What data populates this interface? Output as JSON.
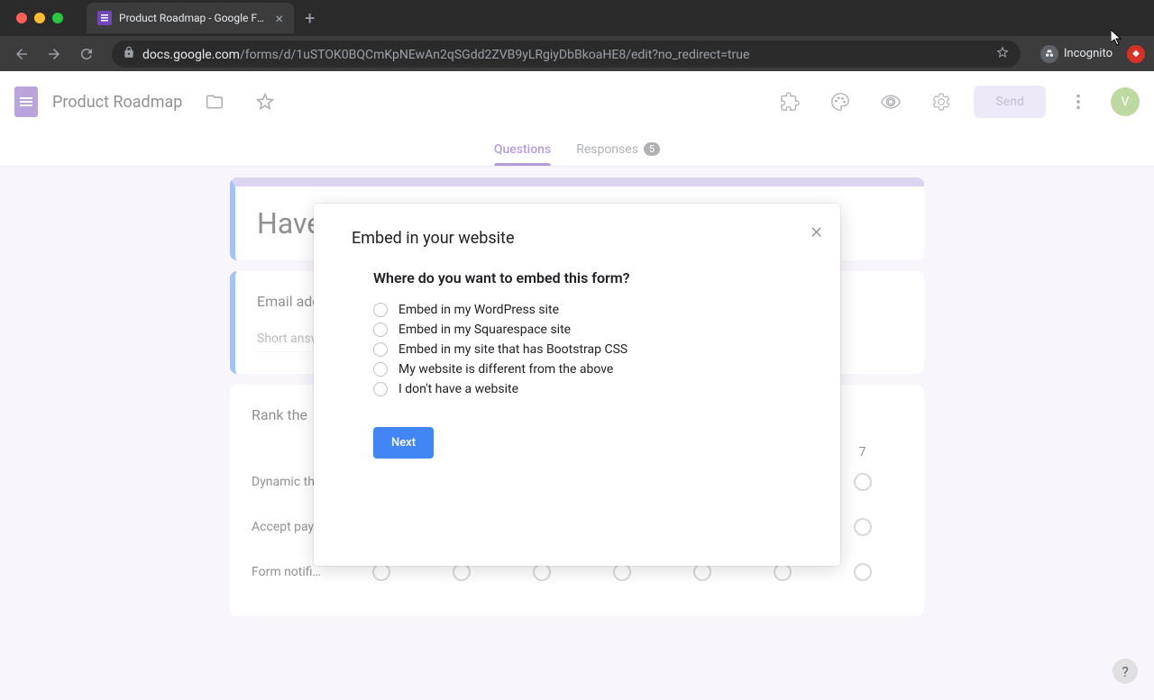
{
  "browser": {
    "tab_title": "Product Roadmap - Google Form",
    "url_host": "docs.google.com",
    "url_path": "/forms/d/1uSTOK0BQCmKpNEwAn2qSGdd2ZVB9yLRgiyDbBkoaHE8/edit?no_redirect=true",
    "incognito_label": "Incognito"
  },
  "header": {
    "form_title": "Product Roadmap",
    "send_label": "Send",
    "avatar_letter": "V"
  },
  "tabs": {
    "questions": "Questions",
    "responses": "Responses",
    "responses_count": "5"
  },
  "form": {
    "title_partial": "Have",
    "q1_label": "Email add",
    "q1_placeholder": "Short answ",
    "q2_label": "Rank the",
    "grid_col_7": "7",
    "grid_rows": [
      "Dynamic th…",
      "Accept pay…",
      "Form notifi…"
    ]
  },
  "modal": {
    "title": "Embed in your website",
    "question": "Where do you want to embed this form?",
    "options": [
      "Embed in my WordPress site",
      "Embed in my Squarespace site",
      "Embed in my site that has Bootstrap CSS",
      "My website is different from the above",
      "I don't have a website"
    ],
    "next_label": "Next"
  },
  "help_label": "?"
}
